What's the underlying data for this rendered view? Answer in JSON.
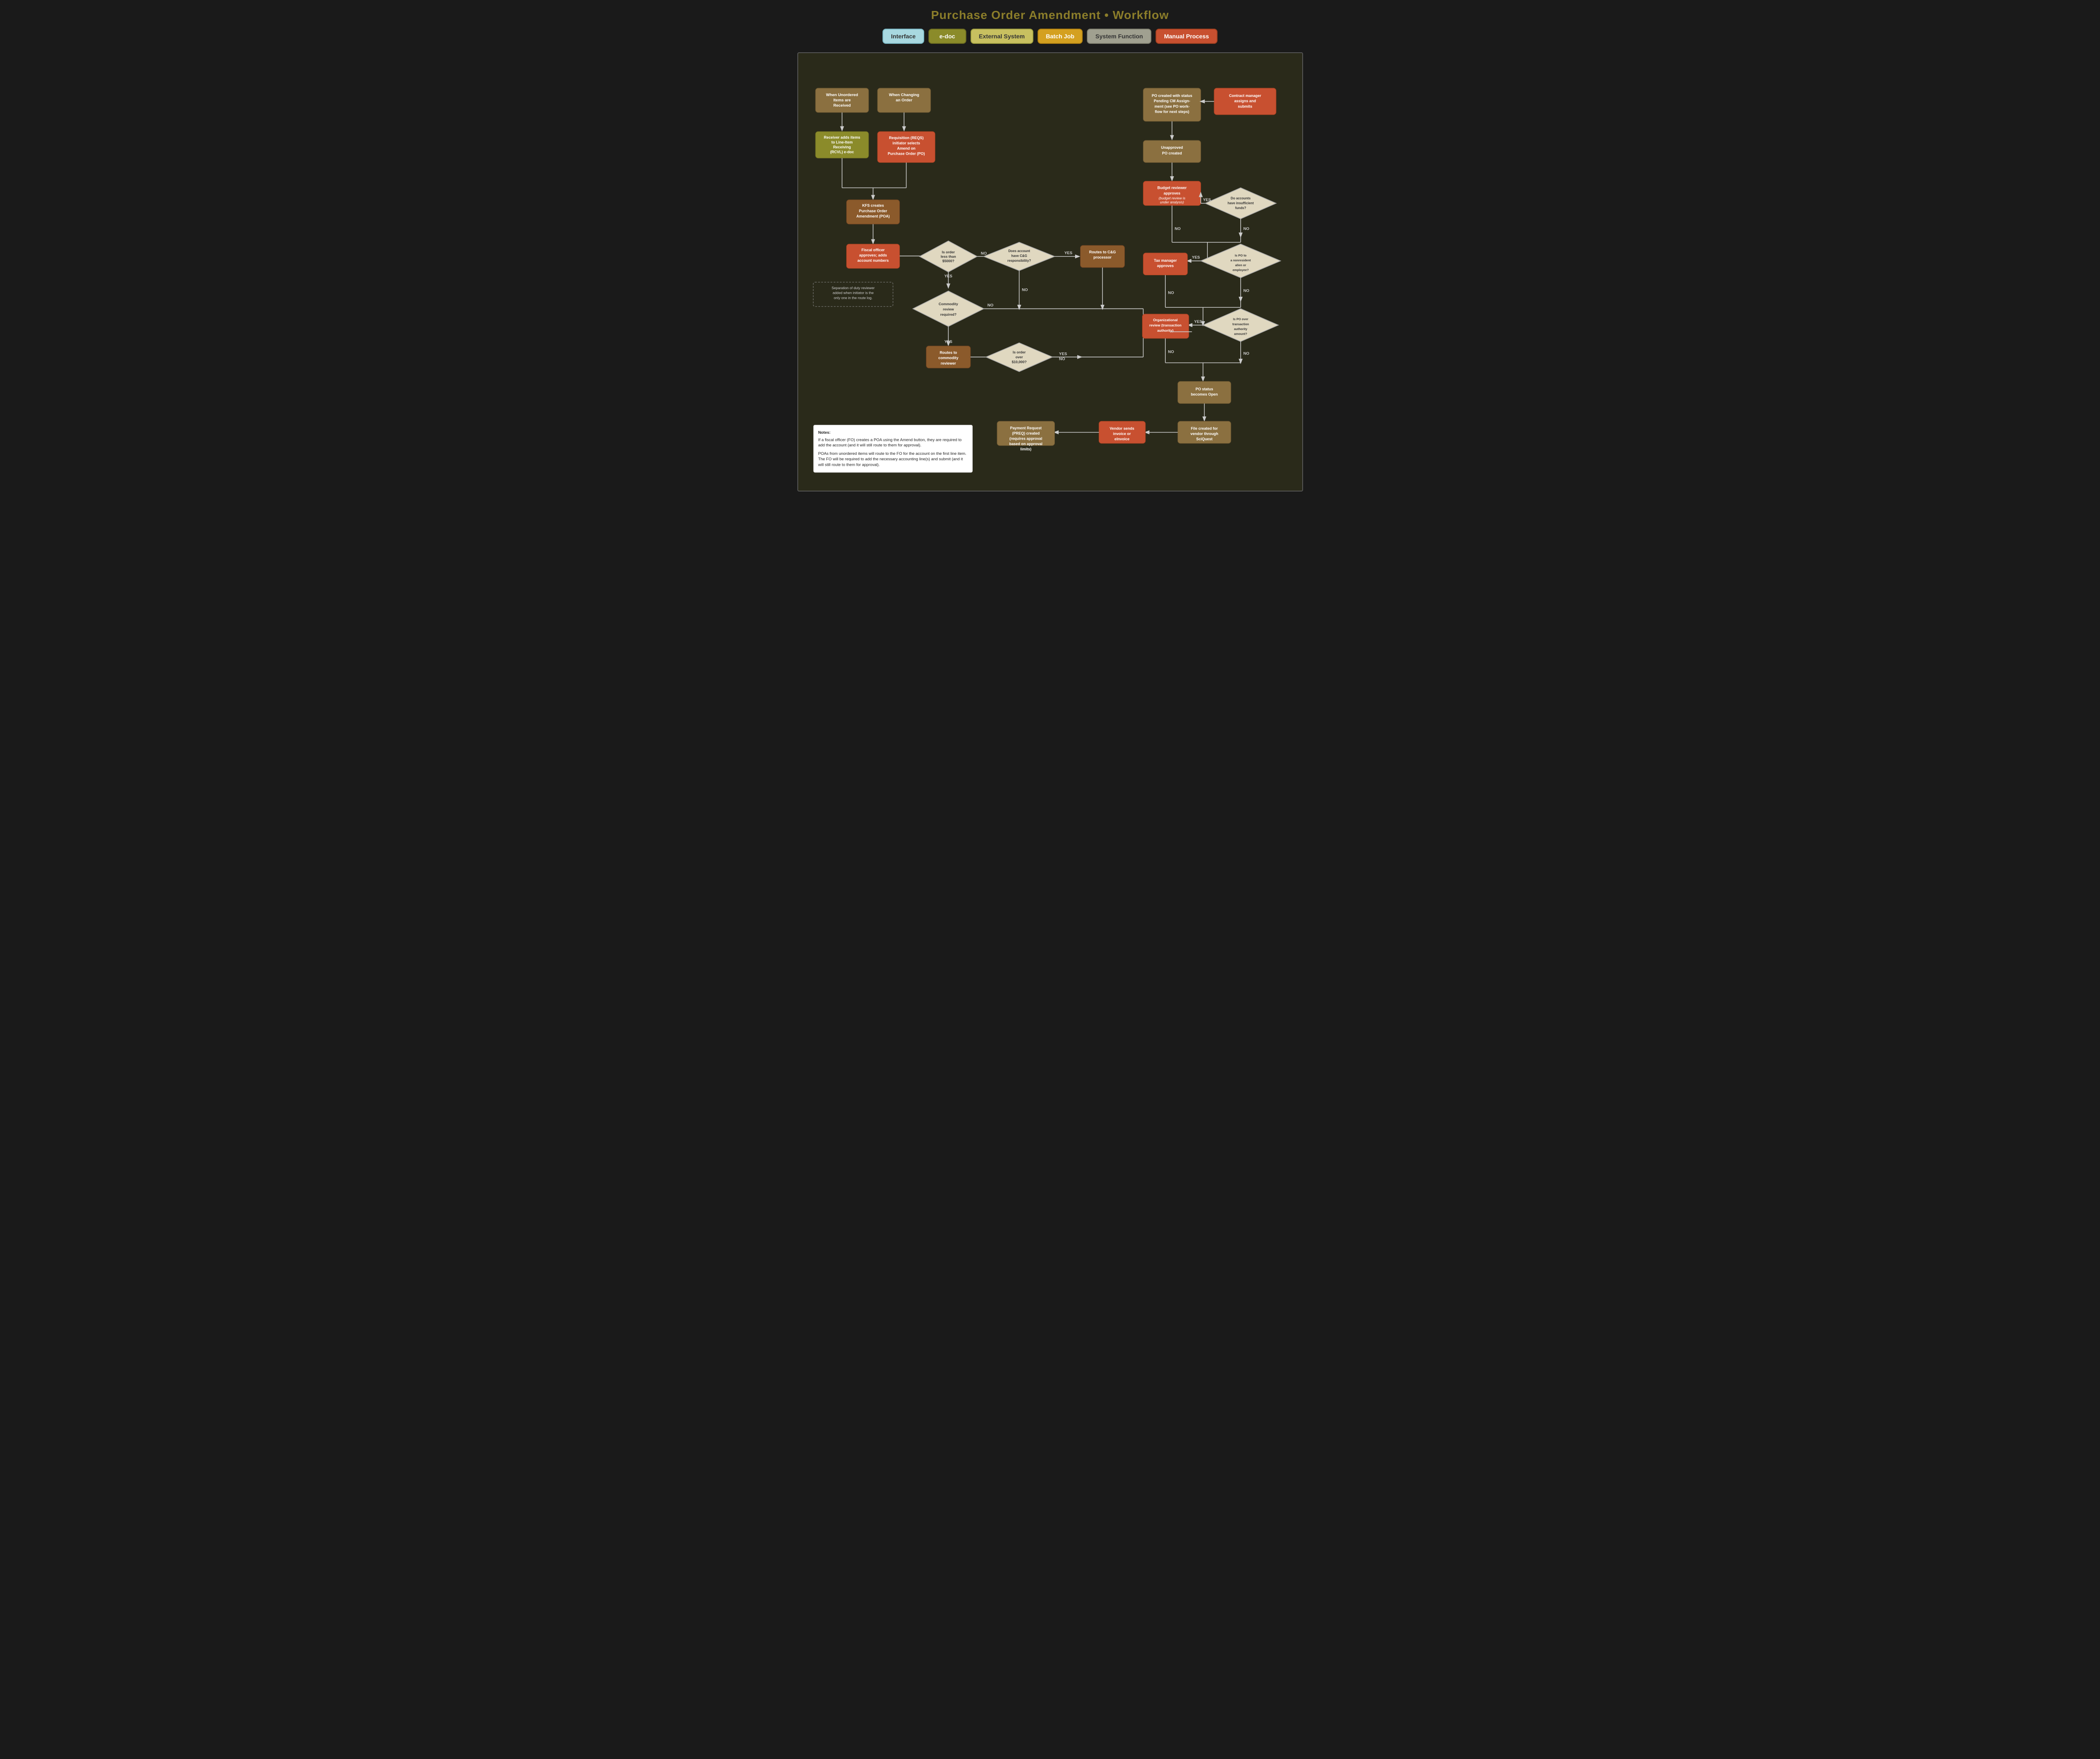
{
  "title": "Purchase Order Amendment • Workflow",
  "legend": [
    {
      "label": "Interface",
      "type": "interface"
    },
    {
      "label": "e-doc",
      "type": "edoc"
    },
    {
      "label": "External System",
      "type": "external"
    },
    {
      "label": "Batch Job",
      "type": "batch"
    },
    {
      "label": "System Function",
      "type": "system"
    },
    {
      "label": "Manual Process",
      "type": "manual"
    }
  ],
  "notes": {
    "title": "Notes:",
    "line1": "If a fiscal officer (FO) creates a POA using the Amend button, they are required to add the account (and it will still route to them for approval).",
    "line2": "POAs from unordered items will route to the FO for the account on the first line item. The FO will be required to add the necessary accounting line(s) and submit (and it will still route to them for approval)."
  }
}
